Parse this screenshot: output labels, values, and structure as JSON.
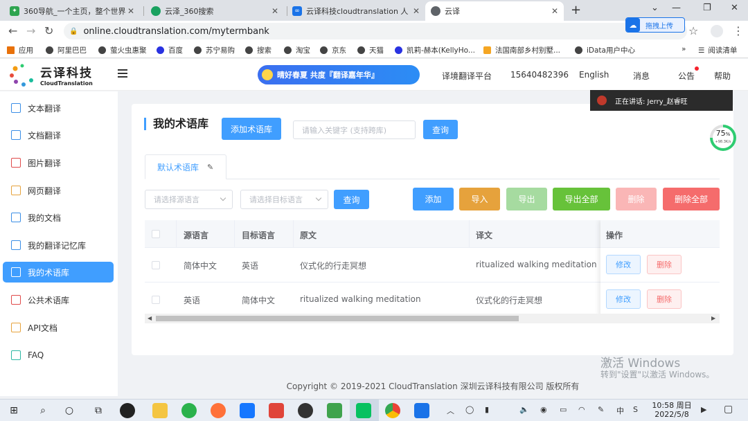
{
  "browser": {
    "tabs": [
      {
        "label": "360导航_一个主页，整个世界",
        "favicon": "360-icon",
        "color": "#2ea44f"
      },
      {
        "label": "云泽_360搜索",
        "favicon": "search-360-icon",
        "color": "#19a15f"
      },
      {
        "label": "云译科技cloudtranslation 人工智",
        "favicon": "cloudtranslation-icon",
        "color": "#1a73e8"
      },
      {
        "label": "云译",
        "favicon": "globe-icon",
        "color": "#5f6368"
      }
    ],
    "url": "online.cloudtranslation.com/mytermbank",
    "upload_label": "拖拽上传",
    "bookmarks": [
      "应用",
      "阿里巴巴",
      "萤火虫惠聚",
      "百度",
      "苏宁易购",
      "搜索",
      "淘宝",
      "京东",
      "天猫",
      "凯莉-赫本(KellyHo...",
      "法国南部乡村别墅...",
      "iData用户中心"
    ],
    "reading_list": "阅读清单",
    "more": "»"
  },
  "header": {
    "logo_cn": "云译科技",
    "logo_en": "CloudTranslation",
    "banner": "晴好春夏 共度『翻译嘉年华』",
    "nav": [
      "译境翻译平台",
      "15640482396",
      "English",
      "消息",
      "公告",
      "帮助"
    ]
  },
  "speaking": "正在讲话: Jerry_赵睿旺",
  "sidebar": {
    "items": [
      {
        "label": "文本翻译",
        "icon": "book-icon"
      },
      {
        "label": "文档翻译",
        "icon": "document-icon"
      },
      {
        "label": "图片翻译",
        "icon": "image-icon"
      },
      {
        "label": "网页翻译",
        "icon": "monitor-icon"
      },
      {
        "label": "我的文档",
        "icon": "file-list-icon"
      },
      {
        "label": "我的翻译记忆库",
        "icon": "folder-icon"
      },
      {
        "label": "我的术语库",
        "icon": "briefcase-icon"
      },
      {
        "label": "公共术语库",
        "icon": "folder-open-icon"
      },
      {
        "label": "API文档",
        "icon": "api-doc-icon"
      },
      {
        "label": "FAQ",
        "icon": "chat-icon"
      }
    ],
    "active_index": 6
  },
  "page": {
    "title": "我的术语库",
    "add_termbank": "添加术语库",
    "keyword_placeholder": "请输入关键字 (支持跨库)",
    "search": "查询",
    "subtab": "默认术语库",
    "src_lang_placeholder": "请选择源语言",
    "tgt_lang_placeholder": "请选择目标语言",
    "filter_search": "查询",
    "actions": {
      "add": "添加",
      "import": "导入",
      "export": "导出",
      "export_all": "导出全部",
      "delete": "删除",
      "delete_all": "删除全部"
    },
    "action_colors": {
      "add": "#409eff",
      "import": "#e6a23c",
      "export": "#a6dba0",
      "export_all": "#67c23a",
      "delete": "#fab6b6",
      "delete_all": "#f56c6c"
    },
    "table": {
      "headers": [
        "源语言",
        "目标语言",
        "原文",
        "译文",
        "操作"
      ],
      "rows": [
        {
          "src": "简体中文",
          "tgt": "英语",
          "original": "仪式化的行走冥想",
          "translation": "ritualized walking meditation",
          "edit": "修改",
          "delete": "删除"
        },
        {
          "src": "英语",
          "tgt": "简体中文",
          "original": "ritualized walking meditation",
          "translation": "仪式化的行走冥想",
          "edit": "修改",
          "delete": "删除"
        }
      ]
    }
  },
  "footer": "Copyright © 2019-2021 CloudTranslation 深圳云译科技有限公司 版权所有",
  "watermark": {
    "title": "激活 Windows",
    "sub": "转到\"设置\"以激活 Windows。"
  },
  "progress": {
    "percent": "75",
    "unit": "%",
    "speed": "+98.3K/s",
    "value": 0.75
  },
  "taskbar": {
    "time": "10:58 周日",
    "date": "2022/5/8",
    "ime": "中"
  }
}
